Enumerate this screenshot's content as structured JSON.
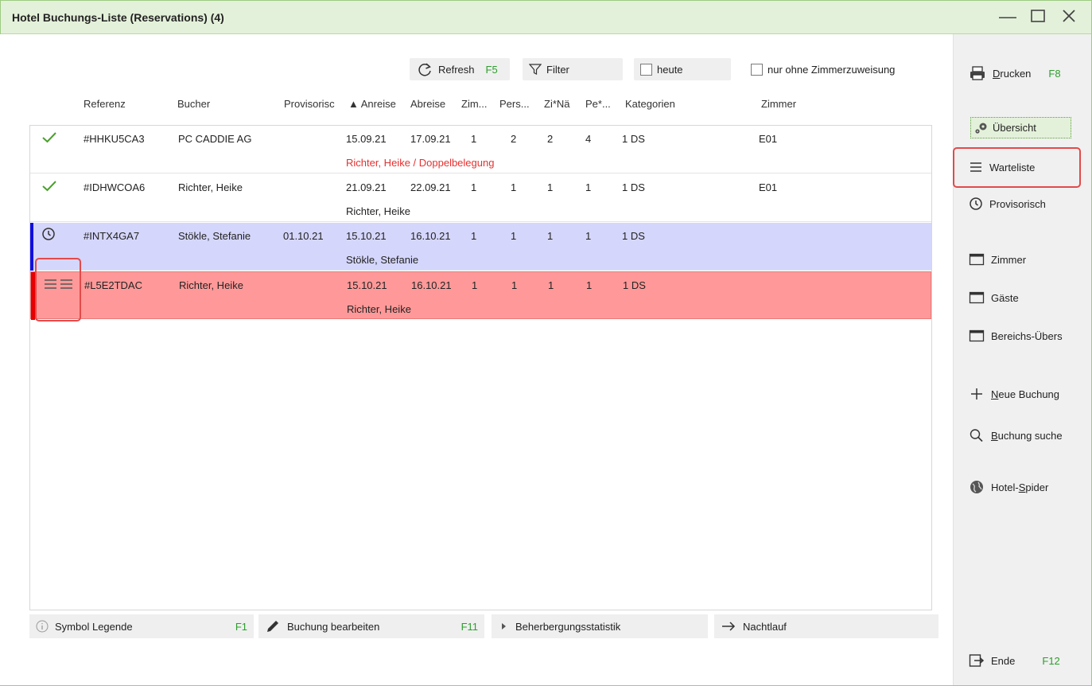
{
  "window": {
    "title": "Hotel Buchungs-Liste (Reservations) (4)"
  },
  "toolbar": {
    "refresh_label": "Refresh",
    "refresh_key": "F5",
    "filter_label": "Filter",
    "heute_label": "heute",
    "nur_ohne_label": "nur ohne Zimmerzuweisung"
  },
  "columns": {
    "referenz": "Referenz",
    "bucher": "Bucher",
    "provisorisch": "Provisorisc",
    "anreise": "▲ Anreise",
    "abreise": "Abreise",
    "zimmer_count": "Zim...",
    "personen": "Pers...",
    "zi_naechte": "Zi*Nä",
    "pe_naechte": "Pe*...",
    "kategorien": "Kategorien",
    "zimmer": "Zimmer"
  },
  "rows": [
    {
      "status": "check",
      "ref": "#HHKU5CA3",
      "bucher": "PC CADDIE AG",
      "prov": "",
      "anreise": "15.09.21",
      "abreise": "17.09.21",
      "zim": "1",
      "pers": "2",
      "zin": "2",
      "pen": "4",
      "kat": "1 DS",
      "zimmer": "E01",
      "sub": "Richter, Heike / Doppelbelegung"
    },
    {
      "status": "check",
      "ref": "#IDHWCOA6",
      "bucher": "Richter, Heike",
      "prov": "",
      "anreise": "21.09.21",
      "abreise": "22.09.21",
      "zim": "1",
      "pers": "1",
      "zin": "1",
      "pen": "1",
      "kat": "1 DS",
      "zimmer": "E01",
      "sub": "Richter, Heike"
    },
    {
      "status": "clock",
      "ref": "#INTX4GA7",
      "bucher": "Stökle, Stefanie",
      "prov": "01.10.21",
      "anreise": "15.10.21",
      "abreise": "16.10.21",
      "zim": "1",
      "pers": "1",
      "zin": "1",
      "pen": "1",
      "kat": "1 DS",
      "zimmer": "",
      "sub": "Stökle, Stefanie"
    },
    {
      "status": "list",
      "ref": "#L5E2TDAC",
      "bucher": "Richter, Heike",
      "prov": "",
      "anreise": "15.10.21",
      "abreise": "16.10.21",
      "zim": "1",
      "pers": "1",
      "zin": "1",
      "pen": "1",
      "kat": "1 DS",
      "zimmer": "",
      "sub": "Richter, Heike"
    }
  ],
  "bottom": {
    "legend_label": "Symbol Legende",
    "legend_key": "F1",
    "edit_label": "Buchung bearbeiten",
    "edit_key": "F11",
    "stats_label": "Beherbergungsstatistik",
    "night_label": "Nachtlauf"
  },
  "sidebar": {
    "drucken_u": "D",
    "drucken_rest": "rucken",
    "drucken_key": "F8",
    "uebersicht": "Übersicht",
    "warteliste": "Warteliste",
    "provisorisch": "Provisorisch",
    "zimmer": "Zimmer",
    "gaeste": "Gäste",
    "bereichs": "Bereichs-Übers",
    "neue_u": "N",
    "neue_rest": "eue Buchung",
    "suche_u": "B",
    "suche_rest": "uchung suche",
    "spider_a": "Hotel-",
    "spider_u": "S",
    "spider_b": "pider",
    "ende": "Ende",
    "ende_key": "F12"
  },
  "colors": {
    "check": "#4aa02c",
    "provisional_row": "#d5d6fb",
    "waiting_row": "#ff9999",
    "highlight": "#e24a4a",
    "fkey": "#2e9e2e"
  }
}
